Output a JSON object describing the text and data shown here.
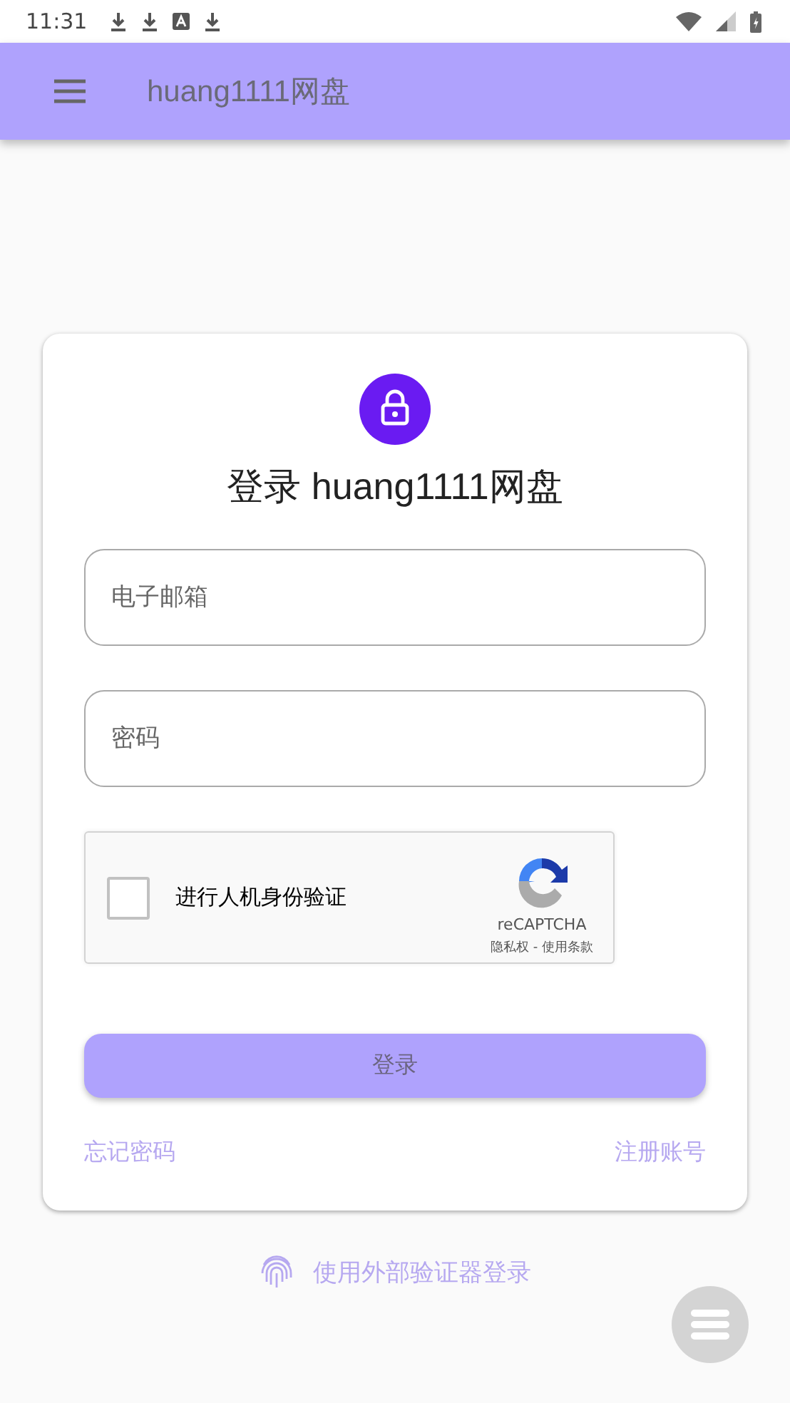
{
  "status_bar": {
    "time": "11:31"
  },
  "app_bar": {
    "title": "huang1111网盘"
  },
  "login_card": {
    "title": "登录 huang1111网盘",
    "fields": [
      {
        "placeholder": "电子邮箱"
      },
      {
        "placeholder": "密码"
      }
    ],
    "captcha": {
      "label": "进行人机身份验证",
      "checked": false,
      "brand": "reCAPTCHA",
      "privacy": "隐私权",
      "separator": " - ",
      "terms": "使用条款"
    },
    "submit": "登录",
    "links": [
      "忘记密码",
      "注册账号"
    ]
  },
  "external_login": "使用外部验证器登录"
}
